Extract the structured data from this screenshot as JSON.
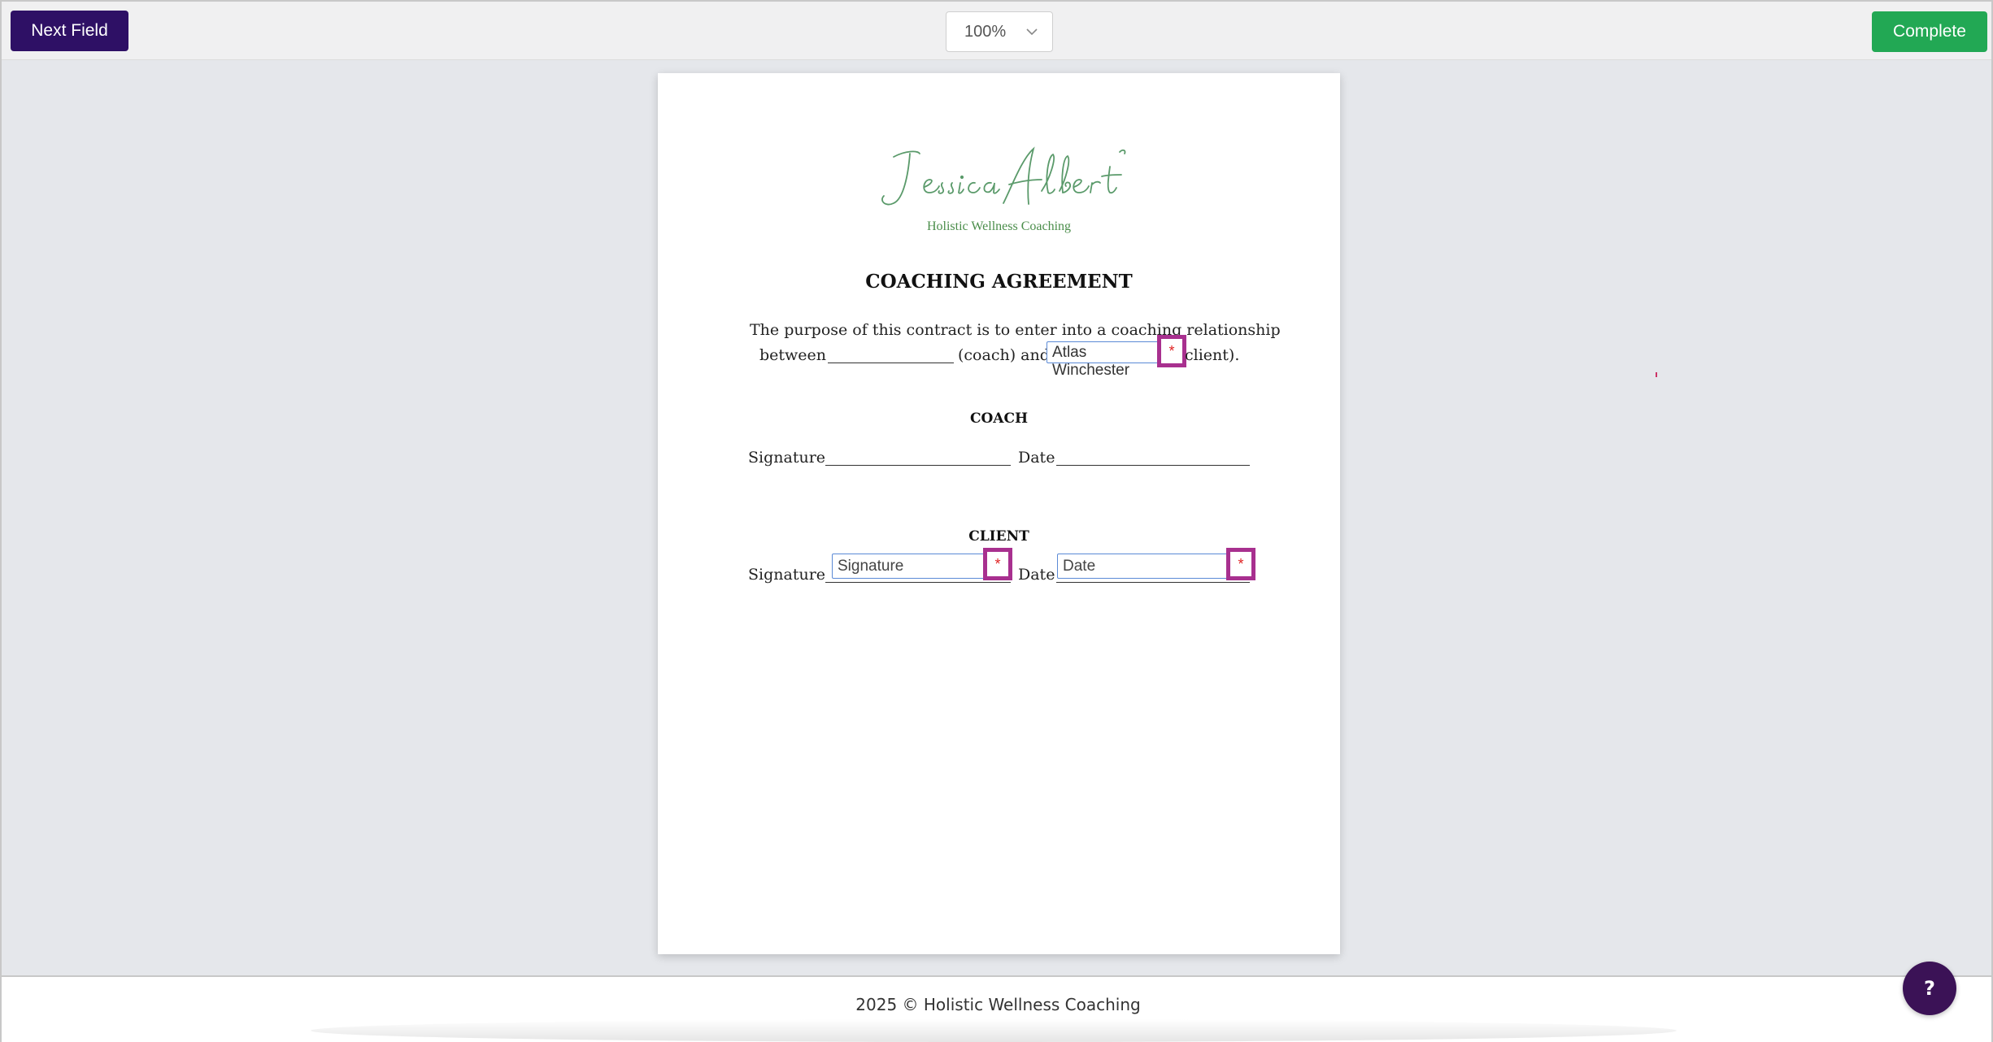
{
  "toolbar": {
    "next_field_label": "Next Field",
    "zoom_value": "100%",
    "complete_label": "Complete"
  },
  "document": {
    "logo_name": "Jessica Albert",
    "logo_subtitle": "Holistic Wellness Coaching",
    "title": "COACHING AGREEMENT",
    "intro_line1": "The purpose of this contract is to enter into a coaching relationship",
    "intro_between": "between",
    "intro_coach": "(coach) and",
    "intro_client": "client).",
    "client_name_value": "Atlas Winchester",
    "coach_heading": "COACH",
    "client_heading": "CLIENT",
    "signature_label": "Signature",
    "date_label": "Date",
    "client_signature_placeholder": "Signature",
    "client_date_placeholder": "Date",
    "required_mark": "*"
  },
  "footer": {
    "copyright": "2025 © Holistic Wellness Coaching"
  },
  "help": {
    "label": "?"
  },
  "colors": {
    "next_button": "#2e1065",
    "complete_button": "#22a854",
    "required_border": "#a8308f",
    "field_border": "#5b8ad6",
    "help_button": "#3b1256"
  }
}
